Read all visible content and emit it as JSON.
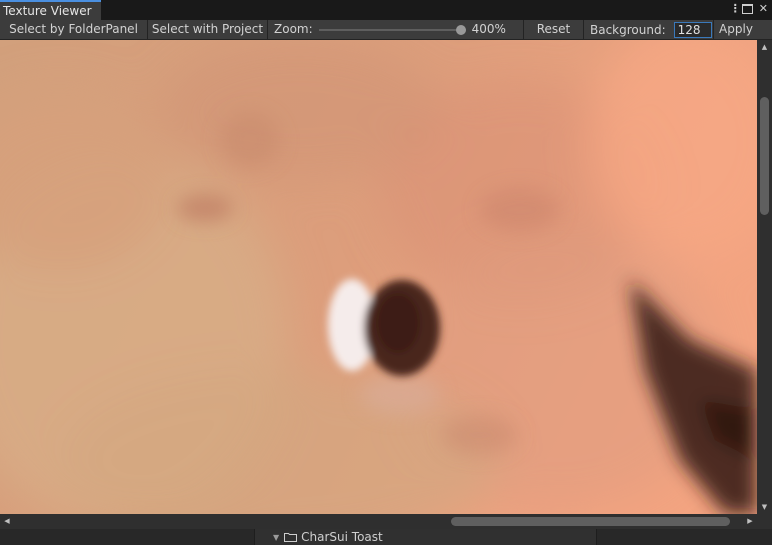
{
  "window": {
    "tab_title": "Texture Viewer"
  },
  "toolbar": {
    "select_folder_label": "Select by FolderPanel",
    "select_project_label": "Select with Project",
    "zoom_label": "Zoom:",
    "zoom_value_text": "400%",
    "zoom_slider_fraction": 1.0,
    "reset_label": "Reset",
    "background_label": "Background:",
    "background_value": "128",
    "apply_label": "Apply"
  },
  "scrollbars": {
    "vertical_position_fraction": 0.13,
    "horizontal_position_fraction": 0.97
  },
  "folder_panel": {
    "folder_name": "CharSui Toast",
    "expanded": true
  },
  "icons": {
    "kebab": "kebab-menu-icon",
    "maximize": "maximize-icon",
    "close": "close-icon",
    "folder": "folder-icon",
    "foldout": "triangle-down-icon"
  },
  "colors": {
    "panel": "#3c3c3c",
    "background": "#191919",
    "accent": "#4a8fe0",
    "texture_base": "#d89a74"
  }
}
